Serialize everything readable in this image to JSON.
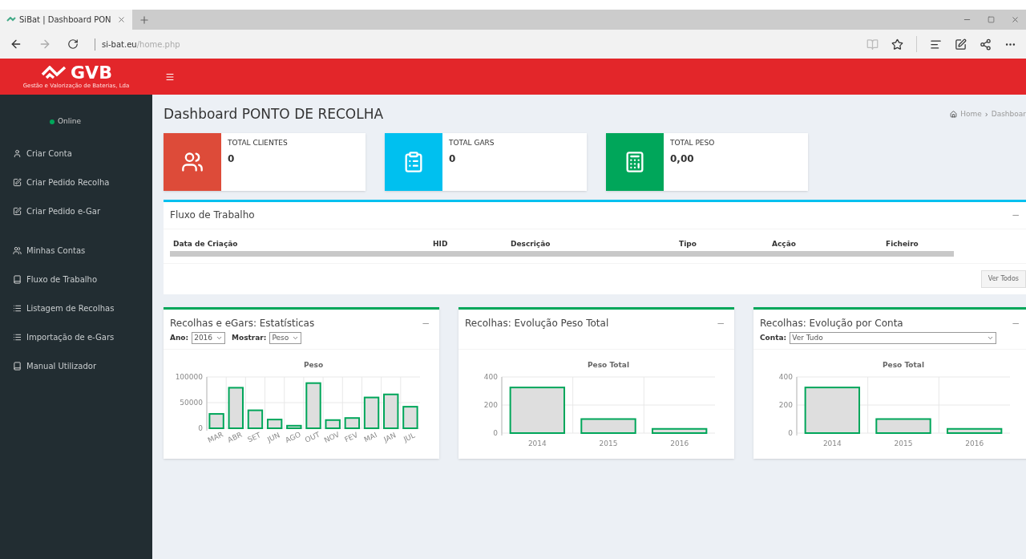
{
  "browser": {
    "tab_title": "SiBat | Dashboard PON",
    "address_domain": "si-bat.eu",
    "address_path": "/home.php"
  },
  "header": {
    "logo": "GVB",
    "logo_subtitle": "Gestão e Valorização de Baterias, Lda"
  },
  "sidebar": {
    "status": "Online",
    "sections": [
      [
        {
          "label": "Criar Conta",
          "kind": "user"
        },
        {
          "label": "Criar Pedido Recolha",
          "kind": "edit"
        },
        {
          "label": "Criar Pedido e-Gar",
          "kind": "edit"
        }
      ],
      [
        {
          "label": "Minhas Contas",
          "kind": "group"
        },
        {
          "label": "Fluxo de Trabalho",
          "kind": "book"
        },
        {
          "label": "Listagem de Recolhas",
          "kind": "list"
        },
        {
          "label": "Importação de e-Gars",
          "kind": "list"
        },
        {
          "label": "Manual Utilizador",
          "kind": "book"
        }
      ]
    ]
  },
  "page": {
    "title": "Dashboard PONTO DE RECOLHA",
    "breadcrumb": [
      "Home",
      "Dashboar"
    ],
    "breadcrumb_separator": "›"
  },
  "info_boxes": [
    {
      "label": "TOTAL CLIENTES",
      "value": "0",
      "color": "#dd4b39",
      "kind": "users"
    },
    {
      "label": "TOTAL GARS",
      "value": "0",
      "color": "#00c0ef",
      "kind": "clipboard"
    },
    {
      "label": "TOTAL PESO",
      "value": "0,00",
      "color": "#00a65a",
      "kind": "calculator"
    }
  ],
  "workflow": {
    "title": "Fluxo de Trabalho",
    "collapse": "−",
    "columns": [
      "Data de Criação",
      "HID",
      "Descrição",
      "Tipo",
      "Acção",
      "Ficheiro"
    ],
    "button": "Ver Todos"
  },
  "chart_panels": [
    {
      "title": "Recolhas e eGars: Estatísticas",
      "collapse": "−",
      "filters": [
        {
          "label": "Ano:",
          "value": "2016",
          "wide": false
        },
        {
          "label": "Mostrar:",
          "value": "Peso",
          "wide": false
        }
      ],
      "chart_data": {
        "type": "bar",
        "title": "Peso",
        "categories": [
          "MAR",
          "ABR",
          "SET",
          "JUN",
          "AGO",
          "OUT",
          "NOV",
          "FEV",
          "MAI",
          "JAN",
          "JUL"
        ],
        "series": [
          {
            "color": "#00a65a",
            "values": [
              28000,
              79000,
              35000,
              17000,
              5000,
              88000,
              16000,
              20000,
              60000,
              66000,
              42000
            ]
          }
        ],
        "ylim": [
          0,
          100000
        ],
        "yticks": [
          0,
          50000,
          100000
        ],
        "grid": true
      }
    },
    {
      "title": "Recolhas: Evolução Peso Total",
      "collapse": "−",
      "chart_data": {
        "type": "bar",
        "title": "Peso Total",
        "categories": [
          "2014",
          "2015",
          "2016"
        ],
        "series": [
          {
            "color": "#00a65a",
            "values": [
              325,
              100,
              30
            ]
          }
        ],
        "ylim": [
          0,
          400
        ],
        "yticks": [
          0,
          200,
          400
        ],
        "grid": true
      }
    },
    {
      "title": "Recolhas: Evolução por Conta",
      "collapse": "−",
      "filters": [
        {
          "label": "Conta:",
          "value": "Ver Tudo",
          "wide": true
        }
      ],
      "chart_data": {
        "type": "bar",
        "title": "Peso Total",
        "categories": [
          "2014",
          "2015",
          "2016"
        ],
        "series": [
          {
            "color": "#00a65a",
            "values": [
              325,
              100,
              30
            ]
          }
        ],
        "ylim": [
          0,
          400
        ],
        "yticks": [
          0,
          200,
          400
        ],
        "grid": true
      }
    }
  ]
}
